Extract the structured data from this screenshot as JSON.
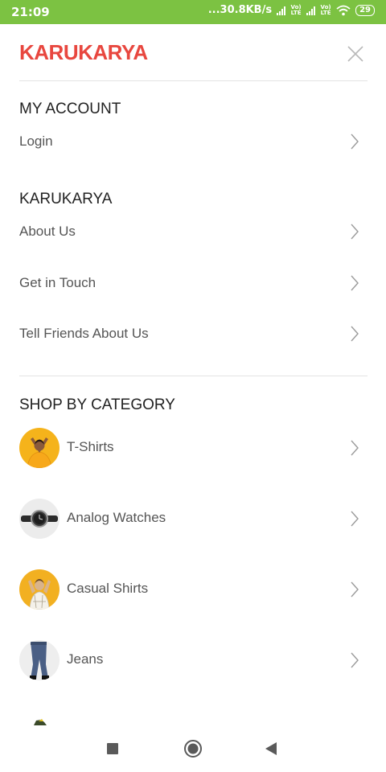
{
  "status": {
    "time": "21:09",
    "speed": "...30.8KB/s",
    "net1": "Vo) LTE",
    "net2": "Vo) LTE",
    "battery": "29"
  },
  "header": {
    "brand": "KARUKARYA",
    "close_icon": "close-icon"
  },
  "account": {
    "title": "MY ACCOUNT",
    "items": [
      {
        "label": "Login"
      }
    ]
  },
  "company": {
    "title": "KARUKARYA",
    "items": [
      {
        "label": "About Us"
      },
      {
        "label": "Get in Touch"
      },
      {
        "label": "Tell Friends About Us"
      }
    ]
  },
  "categories": {
    "title": "SHOP BY CATEGORY",
    "items": [
      {
        "label": "T-Shirts",
        "thumb": "tshirt-model-thumbnail",
        "bg": "#f5b31b"
      },
      {
        "label": "Analog Watches",
        "thumb": "watch-thumbnail",
        "bg": "#ececec"
      },
      {
        "label": "Casual Shirts",
        "thumb": "casual-shirt-model-thumbnail",
        "bg": "#f2b021"
      },
      {
        "label": "Jeans",
        "thumb": "jeans-thumbnail",
        "bg": "#eeeeee"
      }
    ]
  },
  "colors": {
    "statusbar": "#7cc242",
    "brand": "#e8473f",
    "section_text": "#222222",
    "item_text": "#555555",
    "chevron": "#9a9a9a"
  },
  "navbar": {
    "recents_icon": "square-recents-icon",
    "home_icon": "circle-home-icon",
    "back_icon": "triangle-back-icon"
  }
}
